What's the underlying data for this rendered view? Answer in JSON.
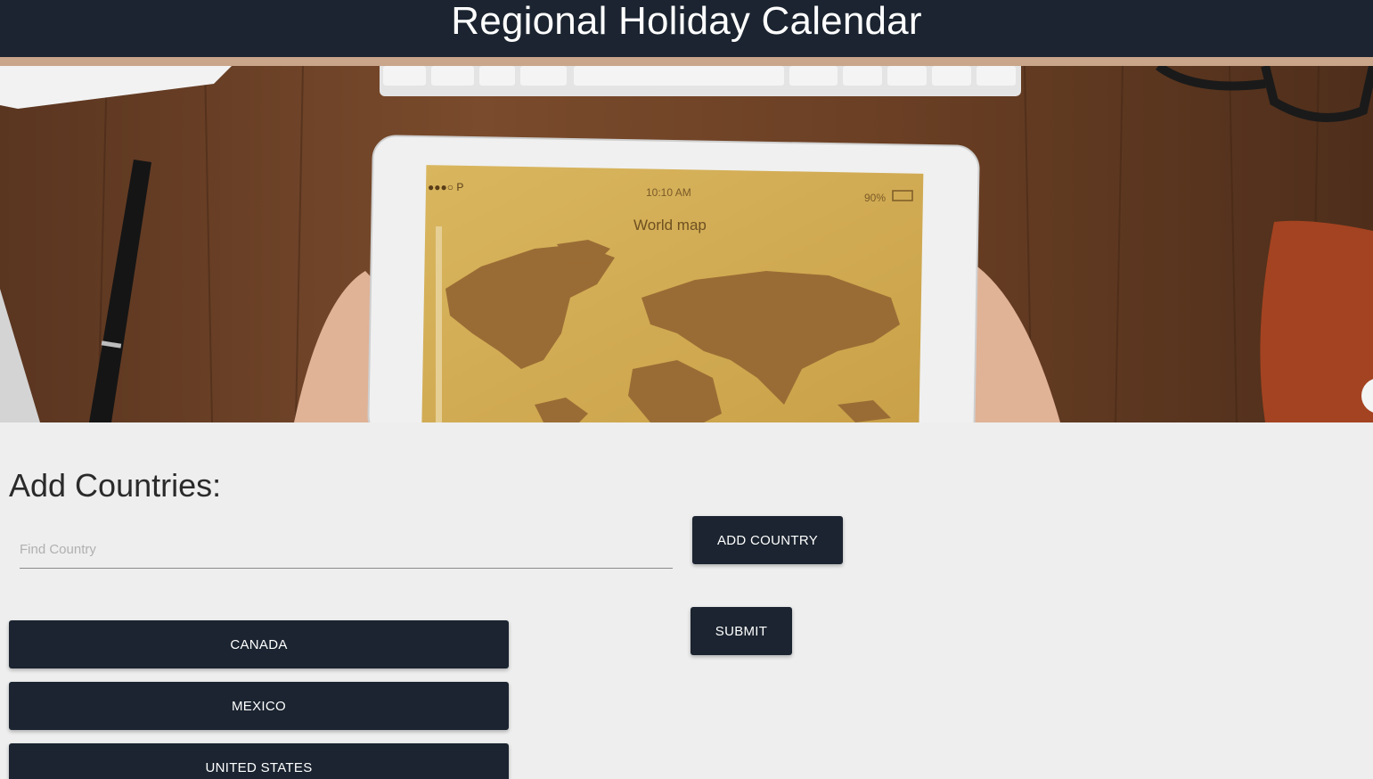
{
  "header": {
    "title": "Regional Holiday Calendar"
  },
  "hero": {
    "tablet_status_time": "10:10 AM",
    "tablet_status_battery": "90%",
    "tablet_status_carrier": "●●●○ P",
    "tablet_screen_title": "World map"
  },
  "section": {
    "title": "Add Countries:"
  },
  "search": {
    "placeholder": "Find Country",
    "value": ""
  },
  "buttons": {
    "add_country": "ADD COUNTRY",
    "submit": "SUBMIT"
  },
  "countries": [
    "CANADA",
    "MEXICO",
    "UNITED STATES"
  ],
  "colors": {
    "header_bg": "#1b2430",
    "accent": "#c9a58a",
    "page_bg": "#eeeeee",
    "button_bg": "#1b2430"
  }
}
